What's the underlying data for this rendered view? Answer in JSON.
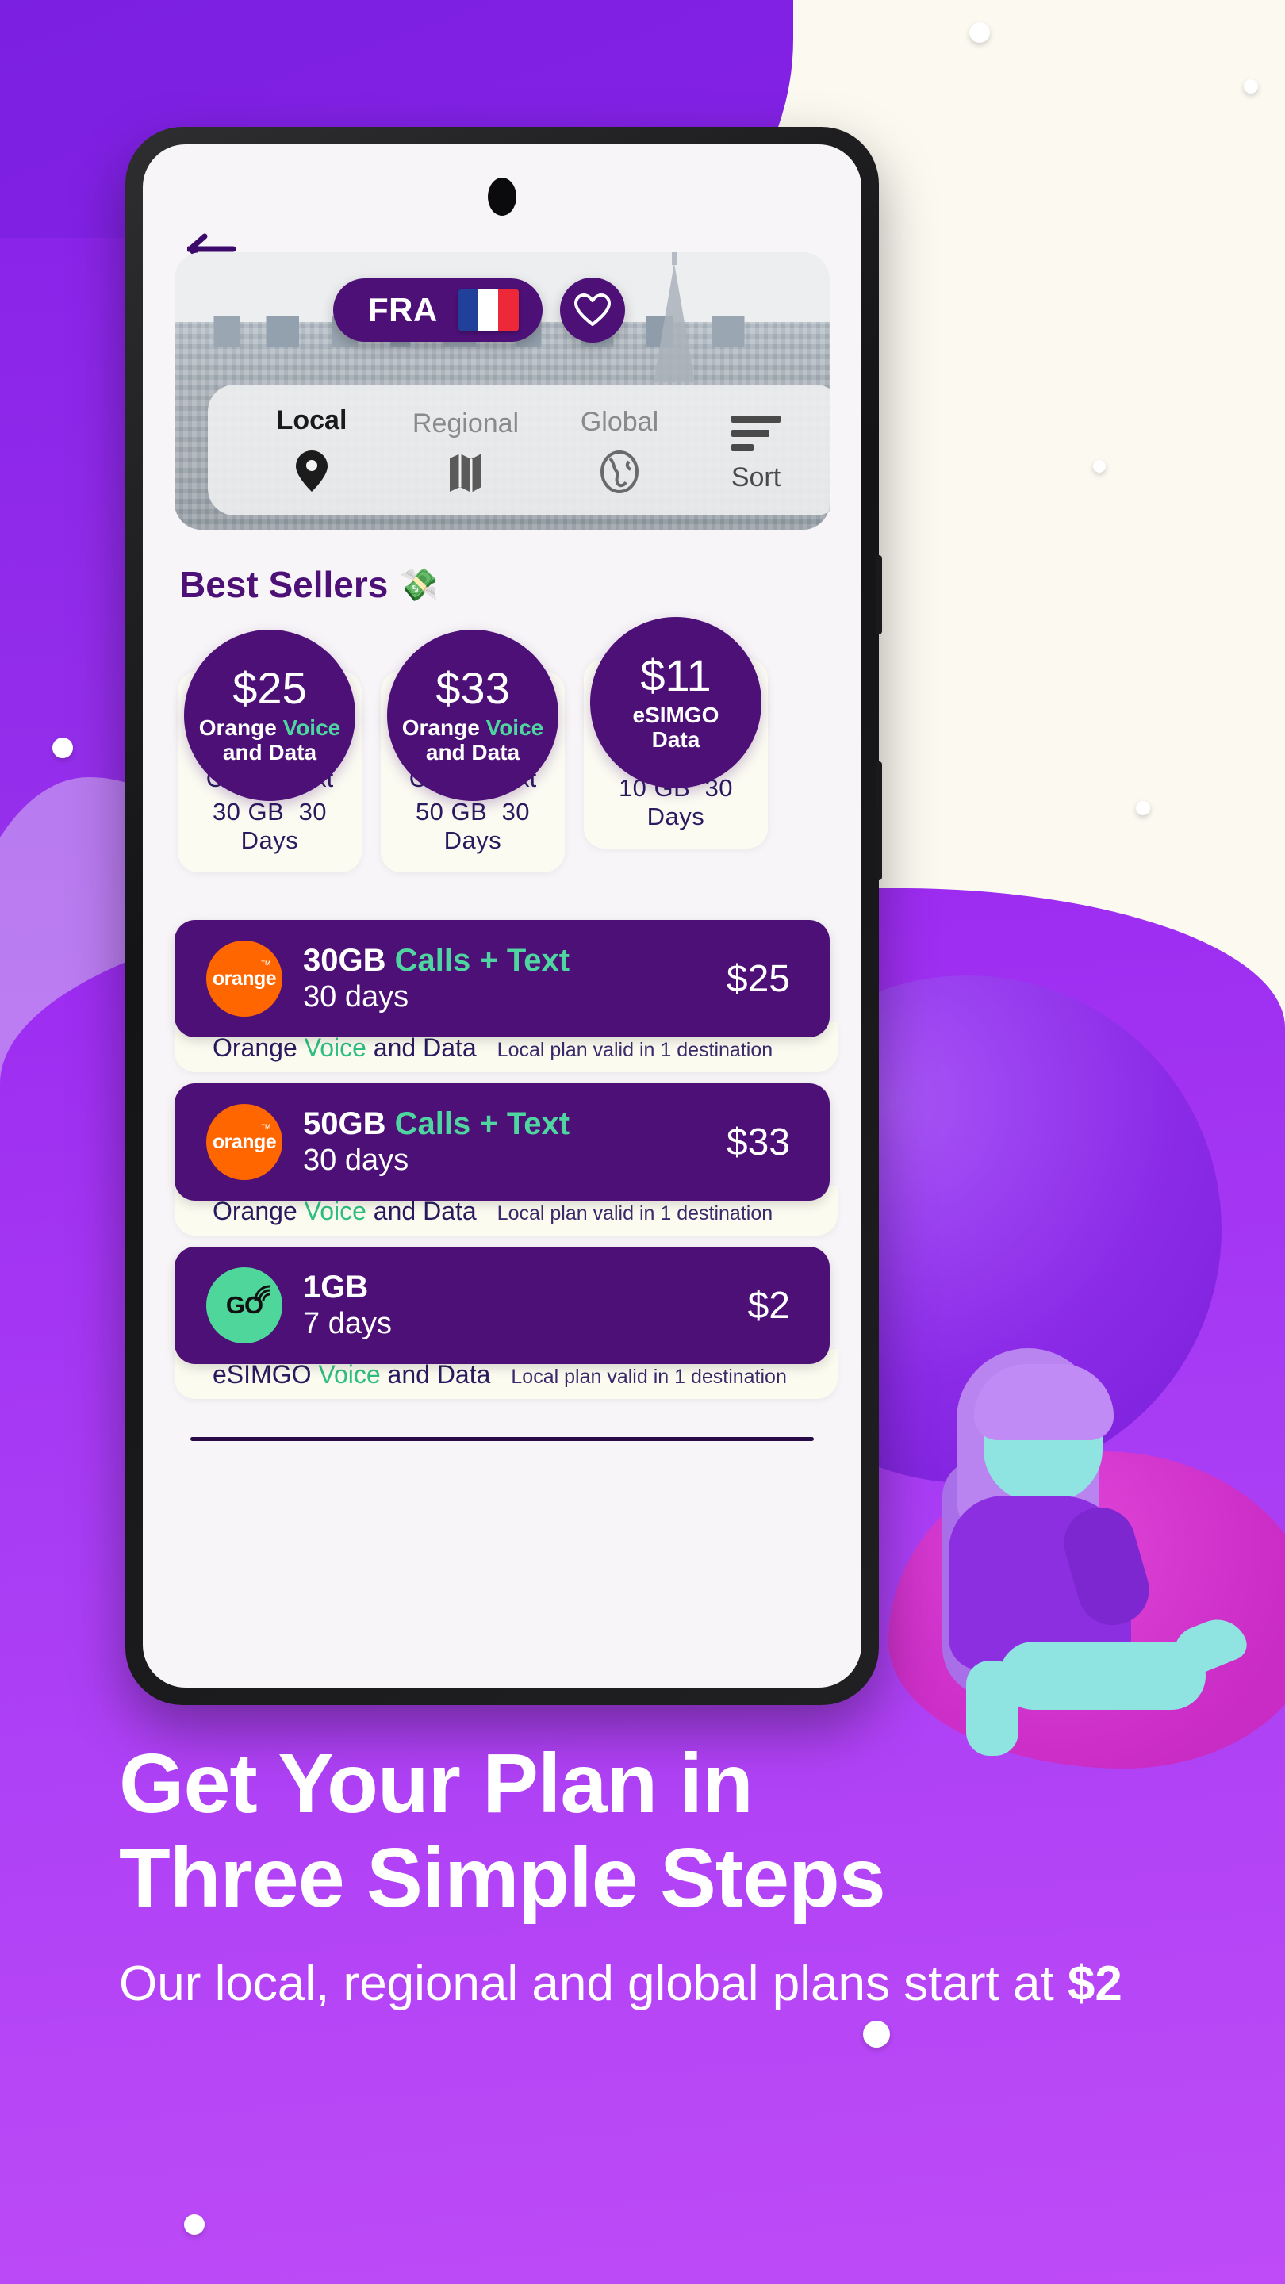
{
  "background": {
    "accent_purple": "#8A24E8",
    "cream": "#FBF9F0",
    "deep_purple": "#4C1076",
    "green": "#4FD6A0"
  },
  "phone": {
    "back_button": "back-arrow"
  },
  "hero": {
    "country_code": "FRA",
    "flag": "france-flag",
    "favorite_icon": "heart-icon",
    "tabs": [
      {
        "label": "Local",
        "icon": "location-pin-icon",
        "active": true
      },
      {
        "label": "Regional",
        "icon": "map-icon",
        "active": false
      },
      {
        "label": "Global",
        "icon": "globe-icon",
        "active": false
      }
    ],
    "sort": {
      "label": "Sort",
      "icon": "sort-lines-icon"
    }
  },
  "best_sellers": {
    "title": "Best Sellers",
    "emoji": "💸",
    "cards": [
      {
        "price": "$25",
        "operator": "Orange",
        "highlight": "Voice",
        "operator_suffix": "and Data",
        "feature": "Calls + Text",
        "data": "30 GB",
        "duration": "30 Days"
      },
      {
        "price": "$33",
        "operator": "Orange",
        "highlight": "Voice",
        "operator_suffix": "and Data",
        "feature": "Calls + Text",
        "data": "50 GB",
        "duration": "30 Days"
      },
      {
        "price": "$11",
        "operator": "eSIMGO",
        "highlight": "",
        "operator_suffix": "Data",
        "feature": "",
        "data": "10 GB",
        "duration": "30 Days"
      }
    ]
  },
  "plans": [
    {
      "logo": "orange-logo",
      "logo_text": "orange",
      "logo_tm": "™",
      "data": "30GB",
      "feature": "Calls + Text",
      "duration": "30 days",
      "price": "$25",
      "footer_operator": "Orange",
      "footer_highlight": "Voice",
      "footer_suffix": "and Data",
      "footer_note": "Local plan valid in 1 destination"
    },
    {
      "logo": "orange-logo",
      "logo_text": "orange",
      "logo_tm": "™",
      "data": "50GB",
      "feature": "Calls + Text",
      "duration": "30 days",
      "price": "$33",
      "footer_operator": "Orange",
      "footer_highlight": "Voice",
      "footer_suffix": "and Data",
      "footer_note": "Local plan valid in 1 destination"
    },
    {
      "logo": "go-logo",
      "logo_text": "GO",
      "logo_tm": "",
      "data": "1GB",
      "feature": "",
      "duration": "7 days",
      "price": "$2",
      "footer_operator": "eSIMGO",
      "footer_highlight": "Voice",
      "footer_suffix": "and Data",
      "footer_note": "Local plan valid in 1 destination"
    }
  ],
  "footer": {
    "headline_line1": "Get Your Plan in",
    "headline_line2": "Three Simple Steps",
    "subline_prefix": "Our local, regional and global plans start at ",
    "subline_price": "$2"
  }
}
